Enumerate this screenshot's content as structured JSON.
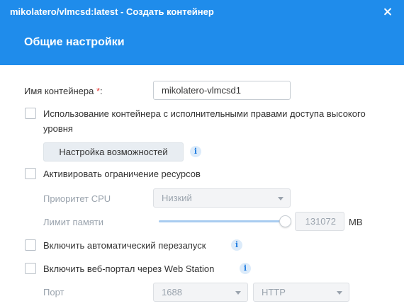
{
  "window": {
    "title": "mikolatero/vlmcsd:latest - Создать контейнер",
    "section_title": "Общие настройки"
  },
  "colors": {
    "header": "#1f8ceb",
    "required": "#e53935",
    "slider": "#a8ccf0"
  },
  "form": {
    "container_name": {
      "label": "Имя контейнера",
      "required_mark": "*",
      "suffix": ":",
      "value": "mikolatero-vlmcsd1"
    },
    "high_privilege": {
      "label": "Использование контейнера с исполнительными правами доступа высокого уровня",
      "checked": false
    },
    "capabilities_button": "Настройка возможностей",
    "resource_limit": {
      "label": "Активировать ограничение ресурсов",
      "checked": false
    },
    "cpu_priority": {
      "label": "Приоритет CPU",
      "value": "Низкий"
    },
    "memory_limit": {
      "label": "Лимит памяти",
      "value": "131072",
      "unit": "MB",
      "slider_level": 1.0
    },
    "auto_restart": {
      "label": "Включить автоматический перезапуск",
      "checked": false
    },
    "web_portal": {
      "label": "Включить веб-портал через Web Station",
      "checked": false
    },
    "port": {
      "label": "Порт",
      "value": "1688",
      "protocol": "HTTP"
    }
  },
  "icons": {
    "info": "info-icon",
    "close": "close-icon",
    "dropdown": "chevron-down-icon"
  }
}
